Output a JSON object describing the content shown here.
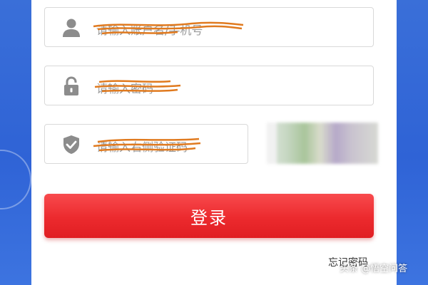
{
  "form": {
    "username_placeholder": "请输入账户名/手机号",
    "password_placeholder": "请输入密码",
    "captcha_placeholder": "请输入右侧验证码",
    "login_label": "登录",
    "forgot_password": "忘记密码"
  },
  "watermark": {
    "text": "头条 @悟空问答"
  },
  "icons": {
    "username": "user-icon",
    "password": "lock-icon",
    "captcha": "shield-check-icon"
  },
  "colors": {
    "accent": "#ec2a2e",
    "background": "#3a6fd8",
    "scribble": "#e07a1f"
  }
}
